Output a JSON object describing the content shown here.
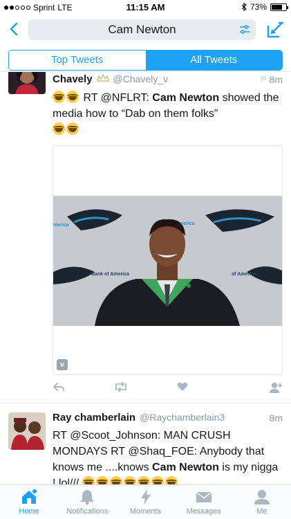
{
  "status_bar": {
    "carrier": "Sprint",
    "network": "LTE",
    "time": "11:15 AM",
    "battery": "73%",
    "battery_level": 0.73
  },
  "nav": {
    "search_query": "Cam Newton"
  },
  "segments": {
    "top": "Top Tweets",
    "all": "All Tweets",
    "selected": "all"
  },
  "tweets": [
    {
      "name": "Chavely",
      "handle": "@Chavely_v",
      "time": "8m",
      "text_prefix": "RT @NFLRT: ",
      "text_bold": "Cam Newton",
      "text_suffix": " showed the media how to “Dab on them folks”",
      "media_label": "v"
    },
    {
      "name": "Ray chamberlain",
      "handle": "@Raychamberlain3",
      "time": "8m",
      "text_prefix": "RT @Scoot_Johnson: MAN CRUSH MONDAYS RT @Shaq_FOE: Anybody that knows me ....knows ",
      "text_bold": "Cam Newton",
      "text_suffix": " is my nigga ! lol///"
    }
  ],
  "tabbar": [
    {
      "label": "Home",
      "icon": "home-icon",
      "active": true
    },
    {
      "label": "Notifications",
      "icon": "bell-icon",
      "active": false
    },
    {
      "label": "Moments",
      "icon": "lightning-icon",
      "active": false
    },
    {
      "label": "Messages",
      "icon": "envelope-icon",
      "active": false
    },
    {
      "label": "Me",
      "icon": "person-icon",
      "active": false
    }
  ],
  "colors": {
    "accent": "#1da1f2",
    "muted": "#8899a6",
    "divider": "#e1e8ed"
  }
}
